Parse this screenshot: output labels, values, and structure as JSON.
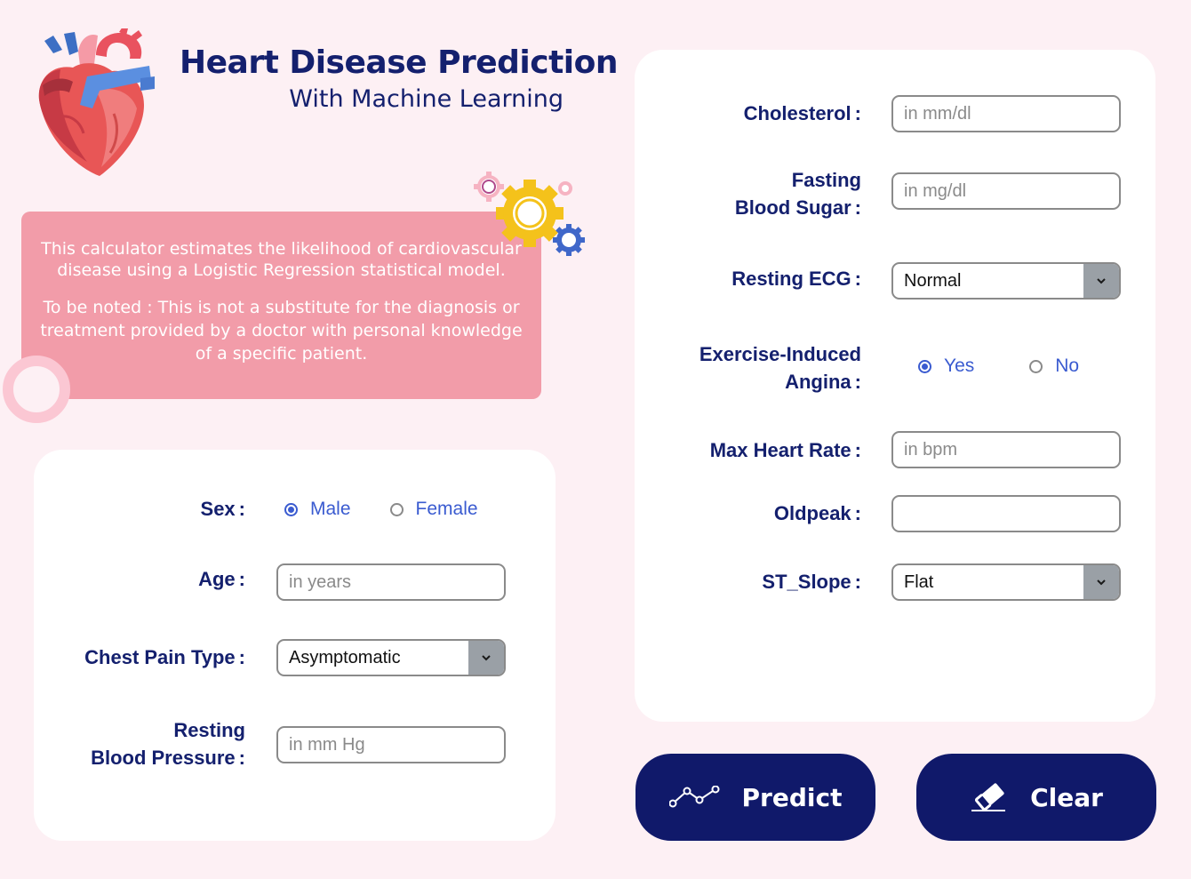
{
  "header": {
    "title": "Heart Disease Prediction",
    "subtitle": "With Machine Learning"
  },
  "info": {
    "paragraph1": "This calculator estimates the likelihood of cardiovascular disease using a Logistic Regression statistical model.",
    "paragraph2": "To be noted :  This is not a substitute for the diagnosis or treatment provided by a doctor with personal knowledge of a specific patient."
  },
  "left_form": {
    "sex": {
      "label": "Sex",
      "options": [
        "Male",
        "Female"
      ],
      "selected": "Male"
    },
    "age": {
      "label": "Age",
      "placeholder": "in years",
      "value": ""
    },
    "chest_pain": {
      "label": "Chest Pain Type",
      "value": "Asymptomatic"
    },
    "resting_bp": {
      "label_line1": "Resting",
      "label_line2": "Blood Pressure",
      "placeholder": "in mm Hg",
      "value": ""
    }
  },
  "right_form": {
    "cholesterol": {
      "label": "Cholesterol",
      "placeholder": "in mm/dl",
      "value": ""
    },
    "fasting_bs": {
      "label_line1": "Fasting",
      "label_line2": "Blood Sugar",
      "placeholder": "in mg/dl",
      "value": ""
    },
    "resting_ecg": {
      "label": "Resting ECG",
      "value": "Normal"
    },
    "angina": {
      "label_line1": "Exercise-Induced",
      "label_line2": "Angina",
      "options": [
        "Yes",
        "No"
      ],
      "selected": "Yes"
    },
    "max_hr": {
      "label": "Max Heart Rate",
      "placeholder": "in bpm",
      "value": ""
    },
    "oldpeak": {
      "label": "Oldpeak",
      "placeholder": "",
      "value": ""
    },
    "st_slope": {
      "label": "ST_Slope",
      "value": "Flat"
    }
  },
  "colon": ":",
  "buttons": {
    "predict": "Predict",
    "clear": "Clear"
  },
  "icons": {
    "logo": "heart-anatomy-icon",
    "gears": "gears-icon",
    "predict": "line-chart-icon",
    "clear": "eraser-icon",
    "dropdown": "chevron-down-icon"
  },
  "colors": {
    "background": "#fdf0f4",
    "navy": "#10196a",
    "info_box": "#f29ca9",
    "radio_accent": "#3a5bd0"
  }
}
